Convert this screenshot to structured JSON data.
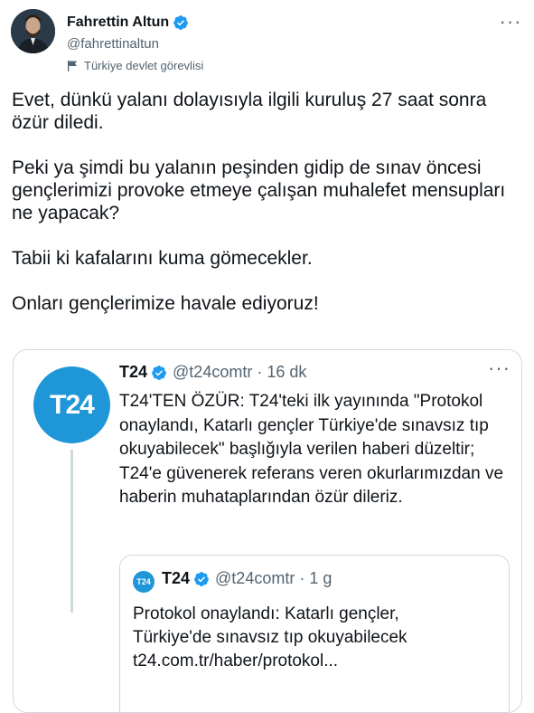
{
  "author": {
    "display_name": "Fahrettin Altun",
    "handle": "@fahrettinaltun",
    "label": "Türkiye devlet görevlisi"
  },
  "tweet": {
    "paragraphs": [
      "Evet, dünkü yalanı dolayısıyla ilgili kuruluş 27 saat sonra özür diledi.",
      "Peki ya şimdi bu yalanın peşinden gidip de sınav öncesi gençlerimizi provoke etmeye çalışan muhalefet mensupları ne yapacak?",
      "Tabii ki kafalarını kuma gömecekler.",
      "Onları gençlerimize havale ediyoruz!"
    ]
  },
  "quoted": {
    "name": "T24",
    "handle_time": "@t24comtr · 16 dk",
    "logo_text": "T24",
    "text": "T24'TEN ÖZÜR: T24'teki ilk yayınında \"Protokol onaylandı, Katarlı gençler Türkiye'de sınavsız tıp okuyabilecek\" başlığıyla verilen haberi düzeltir; T24'e güvenerek referans veren okurlarımızdan ve haberin muhataplarından  özür dileriz.",
    "inner": {
      "name": "T24",
      "handle_time": "@t24comtr · 1 g",
      "logo_text": "T24",
      "text_line1": "Protokol onaylandı: Katarlı gençler,",
      "text_line2": "Türkiye'de sınavsız tıp okuyabilecek",
      "text_line3": "t24.com.tr/haber/protokol..."
    }
  },
  "colors": {
    "accent": "#1d9bf0",
    "t24_blue": "#1e96d8",
    "muted": "#536471",
    "border": "#cfd9de"
  },
  "icons": [
    "verified-badge-icon",
    "government-flag-icon",
    "more-options-icon"
  ]
}
